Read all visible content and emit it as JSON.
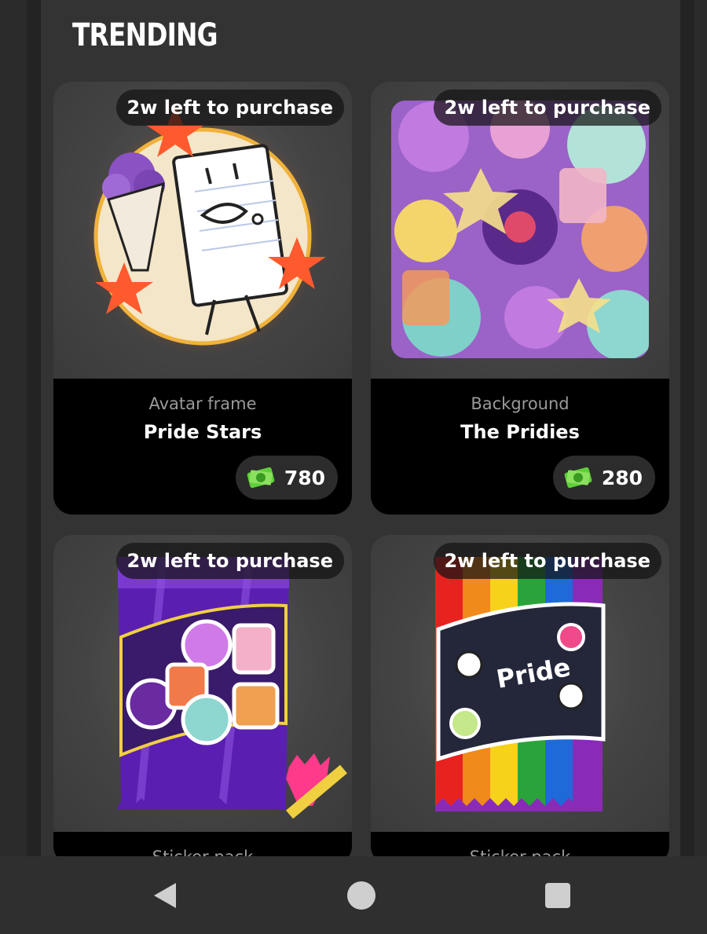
{
  "section": {
    "title": "TRENDING"
  },
  "items": [
    {
      "badge": "2w left to purchase",
      "kind": "Avatar frame",
      "name": "Pride Stars",
      "price": "780"
    },
    {
      "badge": "2w left to purchase",
      "kind": "Background",
      "name": "The Pridies",
      "price": "280"
    },
    {
      "badge": "2w left to purchase",
      "kind": "Sticker pack",
      "name": "",
      "price": ""
    },
    {
      "badge": "2w left to purchase",
      "kind": "Sticker pack",
      "name": "",
      "price": ""
    }
  ],
  "colors": {
    "background": "#2b2b2b",
    "card_info": "#000000",
    "price_pill": "#2c2c2c",
    "currency": "#5fcf3a"
  },
  "icons": {
    "currency": "money-icon",
    "back": "back-triangle-icon",
    "home": "home-circle-icon",
    "recents": "recents-square-icon"
  }
}
